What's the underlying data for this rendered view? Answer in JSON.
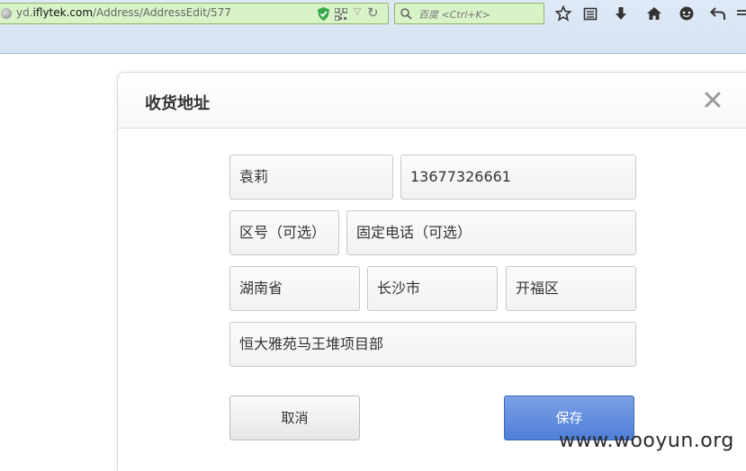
{
  "browser": {
    "url_prefix": "yd.",
    "url_domain": "iflytek.com",
    "url_path": "/Address/AddressEdit/577",
    "search_placeholder": "百度 <Ctrl+K>"
  },
  "modal": {
    "title": "收货地址",
    "close_symbol": "×"
  },
  "form": {
    "name": "袁莉",
    "mobile": "13677326661",
    "area_code": "区号（可选）",
    "landline": "固定电话（可选）",
    "province": "湖南省",
    "city": "长沙市",
    "district": "开福区",
    "address": "恒大雅苑马王堆项目部"
  },
  "buttons": {
    "cancel": "取消",
    "save": "保存"
  },
  "watermark": "www.wooyun.org",
  "colors": {
    "save_button": "#5b88dc",
    "url_bar": "#d9f3c8"
  }
}
